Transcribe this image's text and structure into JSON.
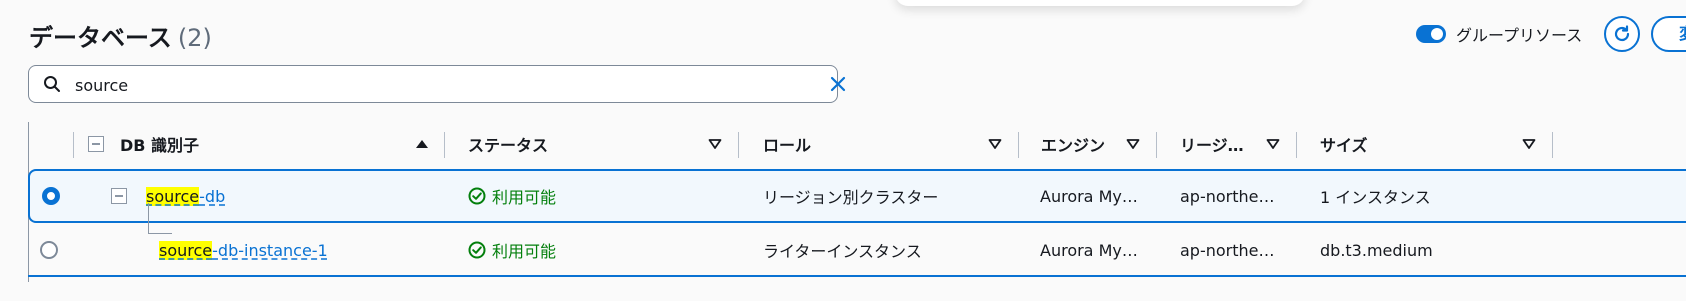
{
  "header": {
    "title": "データベース",
    "count": "(2)",
    "toggle_label": "グループリソース",
    "next_button_partial": "変"
  },
  "search": {
    "value": "source",
    "placeholder": ""
  },
  "table": {
    "columns": [
      "DB 識別子",
      "ステータス",
      "ロール",
      "エンジン",
      "リージ…",
      "サイズ"
    ],
    "rows": [
      {
        "selected": true,
        "id_highlight": "source",
        "id_rest": "-db",
        "status": "利用可能",
        "role": "リージョン別クラスター",
        "engine": "Aurora My…",
        "region": "ap-northe…",
        "size": "1 インスタンス"
      },
      {
        "selected": false,
        "id_highlight": "source",
        "id_rest": "-db-instance-1",
        "status": "利用可能",
        "role": "ライターインスタンス",
        "engine": "Aurora My…",
        "region": "ap-northe…",
        "size": "db.t3.medium"
      }
    ]
  },
  "colors": {
    "accent": "#0972d3",
    "success": "#037f0c",
    "highlight": "#ffff00"
  },
  "icons": [
    "search-icon",
    "clear-icon",
    "refresh-icon",
    "sort-ascending-icon",
    "sort-descending-icon",
    "status-available-icon",
    "expand-collapse-icon"
  ]
}
